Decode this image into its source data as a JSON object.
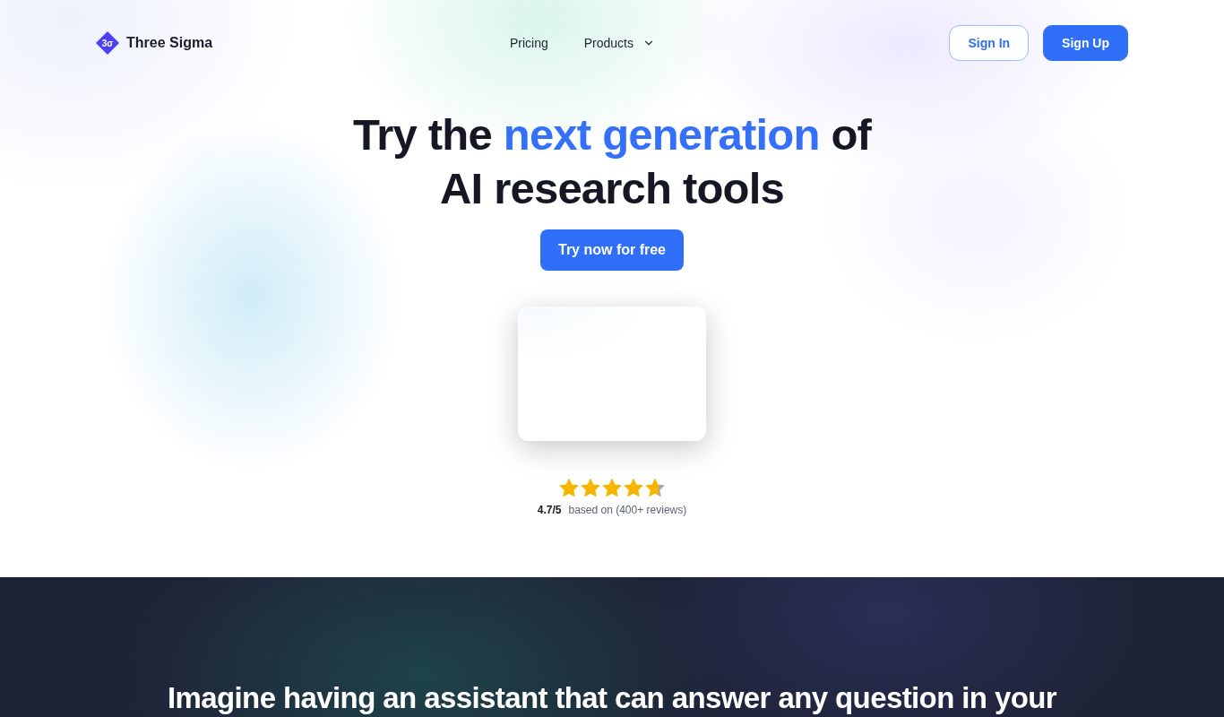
{
  "brand": {
    "mark": "3σ",
    "name": "Three Sigma"
  },
  "nav": {
    "links": [
      {
        "label": "Pricing",
        "kind": "link"
      },
      {
        "label": "Products",
        "kind": "dropdown"
      }
    ],
    "actions": [
      {
        "label": "Sign In",
        "kind": "outline"
      },
      {
        "label": "Sign Up",
        "kind": "filled"
      }
    ]
  },
  "hero": {
    "headline_lines": [
      [
        {
          "text": "Try the ",
          "highlight": false
        },
        {
          "text": "next generation",
          "highlight": true
        },
        {
          "text": " of",
          "highlight": false
        }
      ],
      [
        {
          "text": "AI research tools",
          "highlight": false
        }
      ]
    ],
    "cta": "Try now for free",
    "rating": {
      "stars": 4.7,
      "score": "4.7/5",
      "reviews": "based on (400+ reviews)"
    }
  },
  "feature": {
    "heading": "Imagine having an assistant that can answer any question in your"
  }
}
